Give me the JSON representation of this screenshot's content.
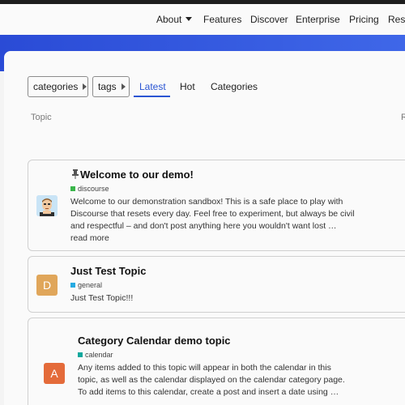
{
  "topnav": {
    "items": [
      {
        "label": "About",
        "has_caret": true
      },
      {
        "label": "Features"
      },
      {
        "label": "Discover"
      },
      {
        "label": "Enterprise"
      },
      {
        "label": "Pricing"
      },
      {
        "label": "Reso"
      }
    ]
  },
  "colors": {
    "brand_blue": "#3557e0",
    "link_blue": "#2a55d3",
    "category_discourse": "#3ab54a",
    "category_general": "#25aae1",
    "category_calendar": "#12a89d",
    "avatar_d": "#e0a65a",
    "avatar_a": "#e46b3a"
  },
  "filters": {
    "categories_label": "categories",
    "tags_label": "tags"
  },
  "tabs": [
    {
      "label": "Latest",
      "active": true
    },
    {
      "label": "Hot"
    },
    {
      "label": "Categories"
    }
  ],
  "columns": {
    "topic": "Topic",
    "right_partial": "R"
  },
  "topics": [
    {
      "title": "Welcome to our demo!",
      "pinned": true,
      "category": "discourse",
      "excerpt_lines": [
        "Welcome to our demonstration sandbox! This is a safe place to play with",
        "Discourse that resets every day. Feel free to experiment, but always be civil",
        "and respectful – and don't post anything here you wouldn't want lost …",
        "read more"
      ],
      "avatar": "user-avatar-image"
    },
    {
      "title": "Just Test Topic",
      "category": "general",
      "excerpt_lines": [
        "Just Test Topic!!!"
      ],
      "avatar_letter": "D"
    },
    {
      "title": "Category Calendar demo topic",
      "category": "calendar",
      "excerpt_lines": [
        "Any items added to this topic will appear in both the calendar in this",
        "topic, as well as the calendar displayed on the calendar category page.",
        "To add items to this calendar, create a post and insert a date using …"
      ],
      "avatar_letter": "A"
    }
  ]
}
